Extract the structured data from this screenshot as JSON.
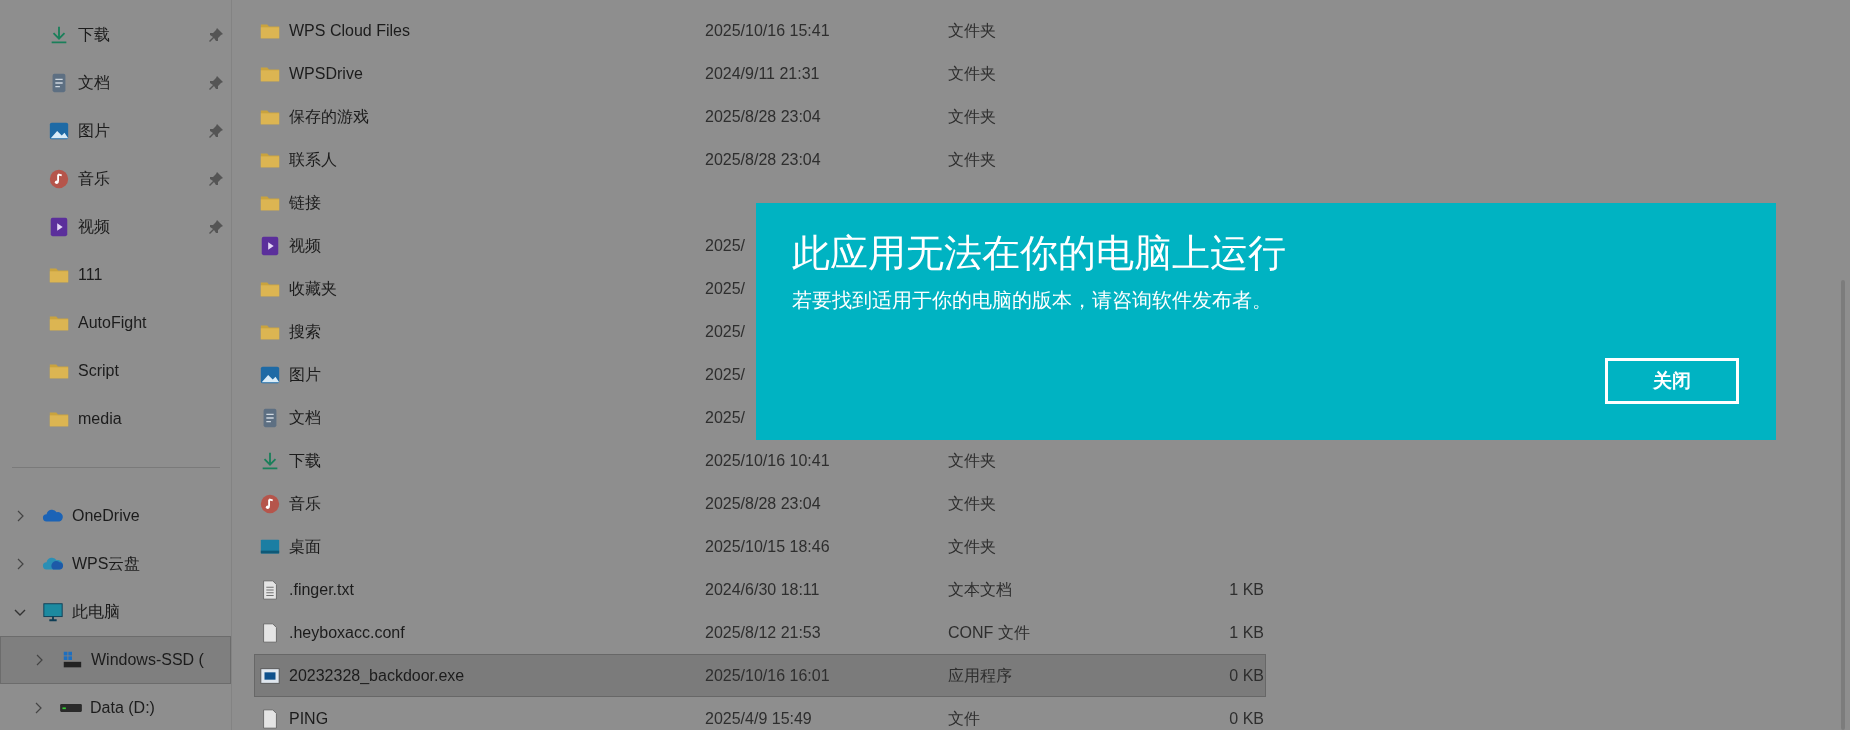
{
  "sidebar": {
    "items": [
      {
        "label": "下载",
        "kind": "downloads",
        "pinned": true,
        "selected": false
      },
      {
        "label": "文档",
        "kind": "documents",
        "pinned": true,
        "selected": false
      },
      {
        "label": "图片",
        "kind": "pictures",
        "pinned": true,
        "selected": false
      },
      {
        "label": "音乐",
        "kind": "music",
        "pinned": true,
        "selected": false
      },
      {
        "label": "视频",
        "kind": "videos",
        "pinned": true,
        "selected": false
      },
      {
        "label": "111",
        "kind": "folder",
        "pinned": false,
        "selected": false
      },
      {
        "label": "AutoFight",
        "kind": "folder",
        "pinned": false,
        "selected": false
      },
      {
        "label": "Script",
        "kind": "folder",
        "pinned": false,
        "selected": false
      },
      {
        "label": "media",
        "kind": "folder",
        "pinned": false,
        "selected": false
      }
    ],
    "tree": [
      {
        "label": "OneDrive",
        "kind": "onedrive",
        "expanded": false,
        "selected": false
      },
      {
        "label": "WPS云盘",
        "kind": "cloud",
        "expanded": false,
        "selected": false
      },
      {
        "label": "此电脑",
        "kind": "pc",
        "expanded": true,
        "selected": false,
        "children": [
          {
            "label": "Windows-SSD (",
            "kind": "system-drive",
            "expanded": false,
            "selected": true
          },
          {
            "label": "Data (D:)",
            "kind": "drive",
            "expanded": false,
            "selected": false
          }
        ]
      }
    ]
  },
  "files": {
    "rows": [
      {
        "name": "WPS Cloud Files",
        "kind": "folder",
        "date": "2025/10/16 15:41",
        "type": "文件夹",
        "selected": false
      },
      {
        "name": "WPSDrive",
        "kind": "folder",
        "date": "2024/9/11 21:31",
        "type": "文件夹",
        "selected": false
      },
      {
        "name": "保存的游戏",
        "kind": "folder",
        "date": "2025/8/28 23:04",
        "type": "文件夹",
        "selected": false
      },
      {
        "name": "联系人",
        "kind": "folder",
        "date": "2025/8/28 23:04",
        "type": "文件夹",
        "selected": false
      },
      {
        "name": "链接",
        "kind": "folder",
        "selected": false
      },
      {
        "name": "视频",
        "kind": "videos",
        "date": "2025/",
        "selected": false
      },
      {
        "name": "收藏夹",
        "kind": "folder",
        "date": "2025/",
        "selected": false
      },
      {
        "name": "搜索",
        "kind": "folder",
        "date": "2025/",
        "selected": false
      },
      {
        "name": "图片",
        "kind": "pictures",
        "date": "2025/",
        "selected": false
      },
      {
        "name": "文档",
        "kind": "documents",
        "date": "2025/",
        "selected": false
      },
      {
        "name": "下载",
        "kind": "downloads",
        "date": "2025/10/16 10:41",
        "type": "文件夹",
        "selected": false
      },
      {
        "name": "音乐",
        "kind": "music",
        "date": "2025/8/28 23:04",
        "type": "文件夹",
        "selected": false
      },
      {
        "name": "桌面",
        "kind": "desktop",
        "date": "2025/10/15 18:46",
        "type": "文件夹",
        "selected": false
      },
      {
        "name": ".finger.txt",
        "kind": "text",
        "date": "2024/6/30 18:11",
        "type": "文本文档",
        "size": "1 KB",
        "selected": false
      },
      {
        "name": ".heyboxacc.conf",
        "kind": "file",
        "date": "2025/8/12 21:53",
        "type": "CONF 文件",
        "size": "1 KB",
        "selected": false
      },
      {
        "name": "20232328_backdoor.exe",
        "kind": "exe",
        "date": "2025/10/16 16:01",
        "type": "应用程序",
        "size": "0 KB",
        "selected": true
      },
      {
        "name": "PING",
        "kind": "file",
        "date": "2025/4/9 15:49",
        "type": "文件",
        "size": "0 KB",
        "selected": false
      }
    ]
  },
  "dialog": {
    "title": "此应用无法在你的电脑上运行",
    "message": "若要找到适用于你的电脑的版本，请咨询软件发布者。",
    "button": "关闭"
  }
}
